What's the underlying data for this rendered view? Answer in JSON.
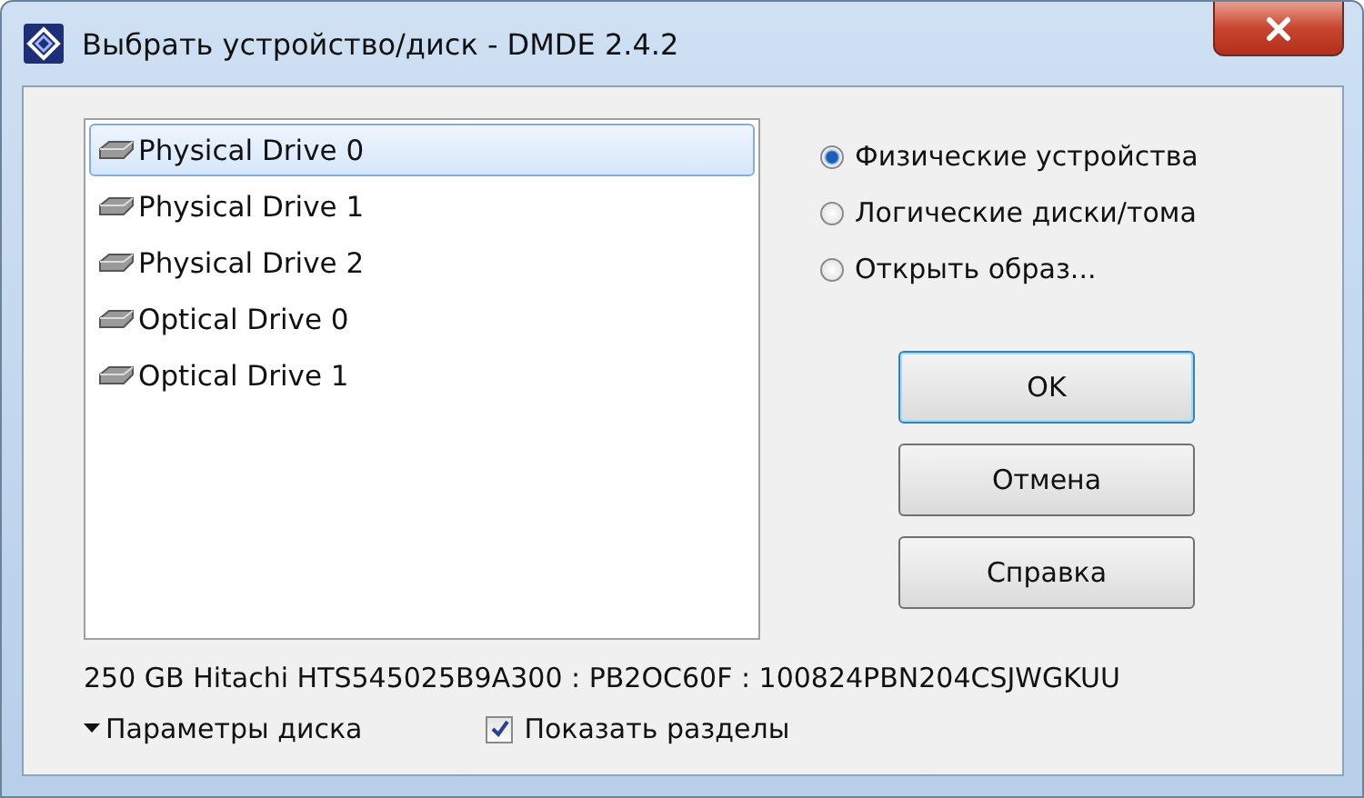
{
  "window": {
    "title": "Выбрать устройство/диск - DMDE 2.4.2"
  },
  "devices": [
    {
      "label": "Physical Drive 0",
      "selected": true
    },
    {
      "label": "Physical Drive 1",
      "selected": false
    },
    {
      "label": "Physical Drive 2",
      "selected": false
    },
    {
      "label": "Optical Drive 0",
      "selected": false
    },
    {
      "label": "Optical Drive 1",
      "selected": false
    }
  ],
  "source_options": [
    {
      "label": "Физические устройства",
      "selected": true
    },
    {
      "label": "Логические диски/тома",
      "selected": false
    },
    {
      "label": "Открыть образ...",
      "selected": false
    }
  ],
  "buttons": [
    {
      "label": "OK",
      "default": true
    },
    {
      "label": "Отмена",
      "default": false
    },
    {
      "label": "Справка",
      "default": false
    }
  ],
  "disk_info": "250 GB Hitachi HTS545025B9A300 : PB2OC60F : 100824PBN204CSJWGKUU",
  "disk_params": {
    "label": "Параметры диска"
  },
  "show_partitions": {
    "label": "Показать разделы",
    "checked": true
  }
}
